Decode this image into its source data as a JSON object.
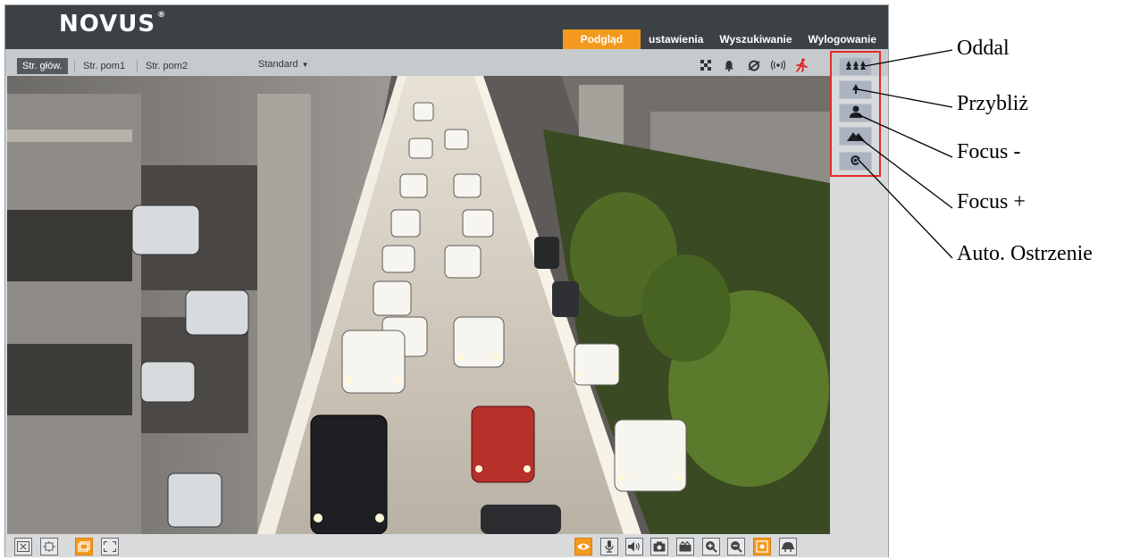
{
  "header": {
    "logo": "NOVUS",
    "logo_mark": "®",
    "tabs": [
      {
        "label": "Podgląd",
        "active": true
      },
      {
        "label": "ustawienia",
        "active": false
      },
      {
        "label": "Wyszukiwanie",
        "active": false
      },
      {
        "label": "Wylogowanie",
        "active": false
      }
    ]
  },
  "stream_tabs": [
    {
      "label": "Str. głów.",
      "active": true
    },
    {
      "label": "Str. pom1",
      "active": false
    },
    {
      "label": "Str. pom2",
      "active": false
    }
  ],
  "image_mode": {
    "selected": "Standard"
  },
  "status_icons": [
    "checker-icon",
    "bell-icon",
    "motion-detect-icon",
    "wireless-icon",
    "running-person-icon"
  ],
  "ptz_buttons": [
    {
      "icon": "zoom-out-trees-icon"
    },
    {
      "icon": "zoom-in-tree-icon"
    },
    {
      "icon": "focus-near-person-icon"
    },
    {
      "icon": "focus-far-mountain-icon"
    },
    {
      "icon": "auto-focus-icon"
    }
  ],
  "callouts": [
    "Oddal",
    "Przybliż",
    "Focus -",
    "Focus +",
    "Auto. Ostrzenie"
  ],
  "bottom_left_buttons": [
    "fullscreen-exit-icon",
    "fit-window-icon",
    "original-size-icon",
    "fullscreen-icon"
  ],
  "bottom_right_buttons": [
    "ptz-eye-icon",
    "microphone-icon",
    "speaker-icon",
    "snapshot-icon",
    "record-icon",
    "zoom-in-icon",
    "zoom-out-icon",
    "digital-zoom-icon",
    "dome-camera-icon"
  ],
  "colors": {
    "accent": "#f39a1e",
    "header_bg": "#3c4146",
    "highlight_box": "#e32a2a",
    "alarm_icon": "#e22222"
  }
}
